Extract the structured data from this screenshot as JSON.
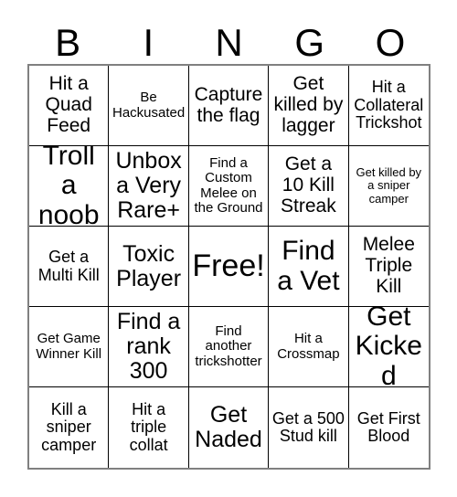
{
  "header": {
    "letters": [
      "B",
      "I",
      "N",
      "G",
      "O"
    ]
  },
  "colors": {
    "grid_line": "#000000",
    "outer_border": "#808080",
    "text": "#000000",
    "background": "#ffffff"
  },
  "grid": {
    "columns": 5,
    "rows": 5,
    "cells": [
      {
        "text": "Hit a Quad Feed",
        "size": "fs-lg"
      },
      {
        "text": "Be Hackusated",
        "size": "fs-sm"
      },
      {
        "text": "Capture the flag",
        "size": "fs-lg"
      },
      {
        "text": "Get killed by lagger",
        "size": "fs-lg"
      },
      {
        "text": "Hit a Collateral Trickshot",
        "size": "fs-md"
      },
      {
        "text": "Troll a noob",
        "size": "fs-xxl"
      },
      {
        "text": "Unbox a Very Rare+",
        "size": "fs-xl"
      },
      {
        "text": "Find a Custom Melee on the Ground",
        "size": "fs-sm"
      },
      {
        "text": "Get a 10 Kill Streak",
        "size": "fs-lg"
      },
      {
        "text": "Get killed by a sniper camper",
        "size": "fs-xs"
      },
      {
        "text": "Get a Multi Kill",
        "size": "fs-md"
      },
      {
        "text": "Toxic Player",
        "size": "fs-xl"
      },
      {
        "text": "Free!",
        "size": "fs-free"
      },
      {
        "text": "Find a Vet",
        "size": "fs-xxl"
      },
      {
        "text": "Melee Triple Kill",
        "size": "fs-lg"
      },
      {
        "text": "Get Game Winner Kill",
        "size": "fs-sm"
      },
      {
        "text": "Find a rank 300",
        "size": "fs-xl"
      },
      {
        "text": "Find another trickshotter",
        "size": "fs-sm"
      },
      {
        "text": "Hit a Crossmap",
        "size": "fs-sm"
      },
      {
        "text": "Get Kicked",
        "size": "fs-xxl"
      },
      {
        "text": "Kill a sniper camper",
        "size": "fs-md"
      },
      {
        "text": "Hit a triple collat",
        "size": "fs-md"
      },
      {
        "text": "Get Naded",
        "size": "fs-xl"
      },
      {
        "text": "Get a 500 Stud kill",
        "size": "fs-md"
      },
      {
        "text": "Get First Blood",
        "size": "fs-md"
      }
    ]
  }
}
